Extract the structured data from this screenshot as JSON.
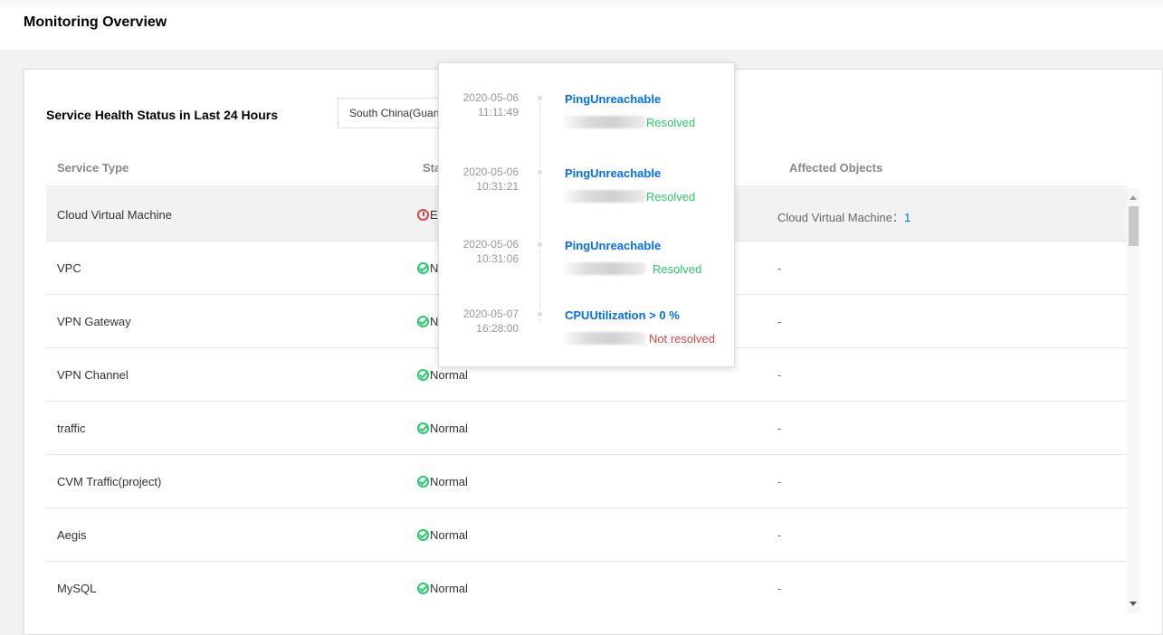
{
  "page": {
    "title": "Monitoring Overview"
  },
  "health": {
    "section_title": "Service Health Status in Last 24 Hours",
    "region_value": "South China(Guangzhou)",
    "columns": [
      "Service Type",
      "Status",
      "Affected Objects"
    ],
    "rows": [
      {
        "service": "Cloud Virtual Machine",
        "status": "Exception",
        "affected_label": "Cloud Virtual Machine：",
        "affected_count": "1",
        "highlight": true
      },
      {
        "service": "VPC",
        "status": "Normal",
        "affected_label": "-",
        "affected_count": ""
      },
      {
        "service": "VPN Gateway",
        "status": "Normal",
        "affected_label": "-",
        "affected_count": ""
      },
      {
        "service": "VPN Channel",
        "status": "Normal",
        "affected_label": "-",
        "affected_count": ""
      },
      {
        "service": "traffic",
        "status": "Normal",
        "affected_label": "-",
        "affected_count": ""
      },
      {
        "service": "CVM Traffic(project)",
        "status": "Normal",
        "affected_label": "-",
        "affected_count": ""
      },
      {
        "service": "Aegis",
        "status": "Normal",
        "affected_label": "-",
        "affected_count": ""
      },
      {
        "service": "MySQL",
        "status": "Normal",
        "affected_label": "-",
        "affected_count": ""
      }
    ]
  },
  "popup": {
    "events": [
      {
        "date": "2020-05-06",
        "time": "11:11:49",
        "title": "PingUnreachable",
        "state": "Resolved",
        "resolved": true
      },
      {
        "date": "2020-05-06",
        "time": "10:31:21",
        "title": "PingUnreachable",
        "state": "Resolved",
        "resolved": true
      },
      {
        "date": "2020-05-06",
        "time": "10:31:06",
        "title": "PingUnreachable",
        "state": "Resolved",
        "resolved": true
      },
      {
        "date": "2020-05-07",
        "time": "16:28:00",
        "title": "CPUUtilization > 0 %",
        "state": "Not resolved",
        "resolved": false
      }
    ]
  },
  "colors": {
    "normal": "#29cc6a",
    "error": "#e54545",
    "link": "#006eff"
  }
}
